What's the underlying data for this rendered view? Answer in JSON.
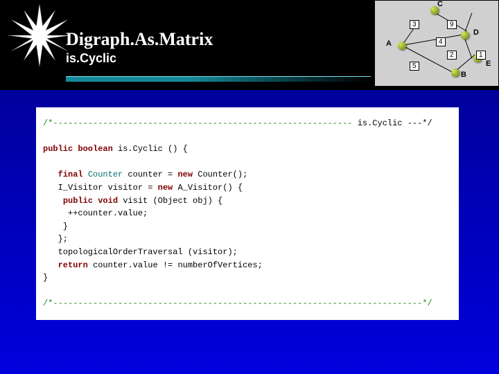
{
  "header": {
    "title": "Digraph.As.Matrix",
    "subtitle": "is.Cyclic"
  },
  "graph": {
    "nodes": {
      "A": "A",
      "B": "B",
      "C": "C",
      "D": "D",
      "E": "E"
    },
    "weights": {
      "w3": "3",
      "w9": "9",
      "w4": "4",
      "w2": "2",
      "w1": "1",
      "w5": "5"
    }
  },
  "code": {
    "comment_top_left": "/*------------------------------------------------------------ ",
    "comment_top_right": "is.Cyclic ---*/",
    "l1_kw1": "public boolean",
    "l1_rest": " is.Cyclic () {",
    "l2_kw1": "final",
    "l2_ty1": " Counter",
    "l2_mid": " counter = ",
    "l2_kw2": "new",
    "l2_rest": " Counter();",
    "l3_pre": "   I_Visitor visitor = ",
    "l3_kw1": "new",
    "l3_rest": " A_Visitor() {",
    "l4_kw1": "public void",
    "l4_rest": " visit (Object obj) {",
    "l5": "     ++counter.value;",
    "l6": "    }",
    "l7": "   };",
    "l8": "   topologicalOrderTraversal (visitor);",
    "l9_kw1": "return",
    "l9_rest": " counter.value != numberOfVertices;",
    "l10": "}",
    "comment_bot": "/*--------------------------------------------------------------------------*/"
  }
}
